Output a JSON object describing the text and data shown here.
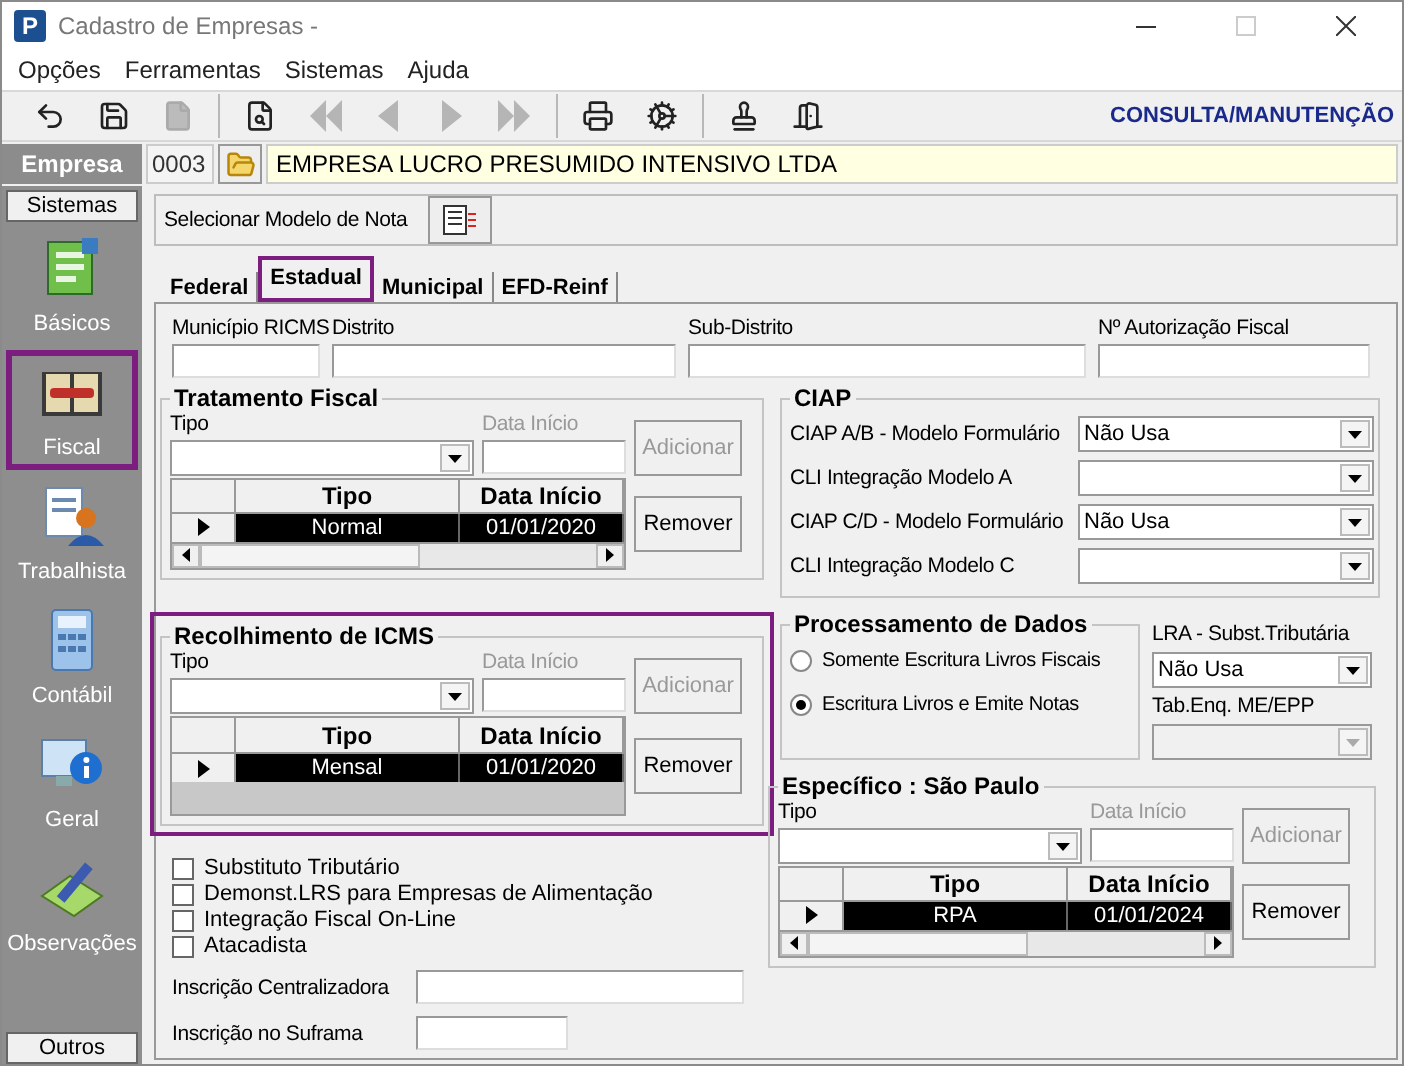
{
  "window": {
    "app_icon": "P",
    "title": "Cadastro de Empresas -"
  },
  "menu": [
    {
      "label": "Opções"
    },
    {
      "label": "Ferramentas"
    },
    {
      "label": "Sistemas"
    },
    {
      "label": "Ajuda"
    }
  ],
  "toolbar": {
    "groups": [
      {
        "buttons": [
          {
            "kind": "undo",
            "disabled": false
          },
          {
            "kind": "save",
            "disabled": false
          },
          {
            "kind": "new",
            "disabled": true
          }
        ]
      },
      {
        "buttons": [
          {
            "kind": "preview",
            "disabled": false
          },
          {
            "kind": "first",
            "disabled": true
          },
          {
            "kind": "prev",
            "disabled": true
          },
          {
            "kind": "next",
            "disabled": true
          },
          {
            "kind": "last",
            "disabled": true
          }
        ]
      },
      {
        "buttons": [
          {
            "kind": "print",
            "disabled": false
          },
          {
            "kind": "tools",
            "disabled": false
          }
        ]
      },
      {
        "buttons": [
          {
            "kind": "stamp",
            "disabled": false
          },
          {
            "kind": "exit",
            "disabled": false
          }
        ]
      }
    ],
    "mode": "CONSULTA/MANUTENÇÃO"
  },
  "company": {
    "label": "Empresa",
    "code": "0003",
    "name": "EMPRESA LUCRO PRESUMIDO INTENSIVO LTDA"
  },
  "sidebar": {
    "header": "Sistemas",
    "footer": "Outros",
    "items": [
      {
        "label": "Básicos",
        "kind": "basicos",
        "selected": false
      },
      {
        "label": "Fiscal",
        "kind": "fiscal",
        "selected": true
      },
      {
        "label": "Trabalhista",
        "kind": "trabalhista",
        "selected": false
      },
      {
        "label": "Contábil",
        "kind": "contabil",
        "selected": false
      },
      {
        "label": "Geral",
        "kind": "geral",
        "selected": false
      },
      {
        "label": "Observações",
        "kind": "observacoes",
        "selected": false
      }
    ]
  },
  "note_model": {
    "label": "Selecionar Modelo de Nota"
  },
  "tabs": [
    {
      "label": "Federal",
      "selected": false
    },
    {
      "label": "Estadual",
      "selected": true
    },
    {
      "label": "Municipal",
      "selected": false
    },
    {
      "label": "EFD-Reinf",
      "selected": false
    }
  ],
  "top_fields": [
    {
      "label": "Município RICMS"
    },
    {
      "label": "Distrito"
    },
    {
      "label": "Sub-Distrito"
    },
    {
      "label": "Nº Autorização Fiscal"
    }
  ],
  "tratamento_fiscal": {
    "title": "Tratamento Fiscal",
    "highlighted": false,
    "type_label": "Tipo",
    "date_label": "Data Início",
    "date_disabled": true,
    "add": {
      "label": "Adicionar",
      "disabled": true
    },
    "remove": {
      "label": "Remover",
      "disabled": false
    },
    "columns": [
      "Tipo",
      "Data Início"
    ],
    "scrollbar": true,
    "rows": [
      {
        "cells": [
          "Normal",
          "01/01/2020"
        ],
        "selected": true
      }
    ]
  },
  "recolhimento_icms": {
    "title": "Recolhimento de ICMS",
    "highlighted": true,
    "type_label": "Tipo",
    "date_label": "Data Início",
    "date_disabled": true,
    "add": {
      "label": "Adicionar",
      "disabled": true
    },
    "remove": {
      "label": "Remover",
      "disabled": false
    },
    "columns": [
      "Tipo",
      "Data Início"
    ],
    "scrollbar": false,
    "rows": [
      {
        "cells": [
          "Mensal",
          "01/01/2020"
        ],
        "selected": true
      }
    ]
  },
  "checkboxes": [
    {
      "label": "Substituto Tributário",
      "checked": false
    },
    {
      "label": "Demonst.LRS para Empresas de Alimentação",
      "checked": false
    },
    {
      "label": "Integração Fiscal On-Line",
      "checked": false
    },
    {
      "label": "Atacadista",
      "checked": false
    }
  ],
  "inscricoes": [
    {
      "label": "Inscrição Centralizadora",
      "wide": true
    },
    {
      "label": "Inscrição no Suframa",
      "wide": false
    }
  ],
  "ciap": {
    "title": "CIAP",
    "rows": [
      {
        "label": "CIAP  A/B - Modelo Formulário",
        "value": "Não Usa"
      },
      {
        "label": "CLI Integração Modelo A"
      },
      {
        "label": "CIAP C/D - Modelo Formulário",
        "value": "Não Usa"
      },
      {
        "label": "CLI Integração Modelo C"
      }
    ]
  },
  "processamento": {
    "title": "Processamento de Dados",
    "options": [
      {
        "label": "Somente Escritura Livros Fiscais",
        "selected": false
      },
      {
        "label": "Escritura Livros e Emite Notas",
        "selected": true
      }
    ]
  },
  "lra": {
    "label": "LRA - Subst.Tributária",
    "value": "Não Usa"
  },
  "tab_enq": {
    "label": "Tab.Enq. ME/EPP",
    "disabled": true
  },
  "especifico": {
    "title": "Específico : São Paulo",
    "highlighted": false,
    "type_label": "Tipo",
    "date_label": "Data Início",
    "date_disabled": true,
    "add": {
      "label": "Adicionar",
      "disabled": true
    },
    "remove": {
      "label": "Remover",
      "disabled": false
    },
    "columns": [
      "Tipo",
      "Data Início"
    ],
    "scrollbar": true,
    "rows": [
      {
        "cells": [
          "RPA",
          "01/01/2024"
        ],
        "selected": true
      }
    ]
  }
}
